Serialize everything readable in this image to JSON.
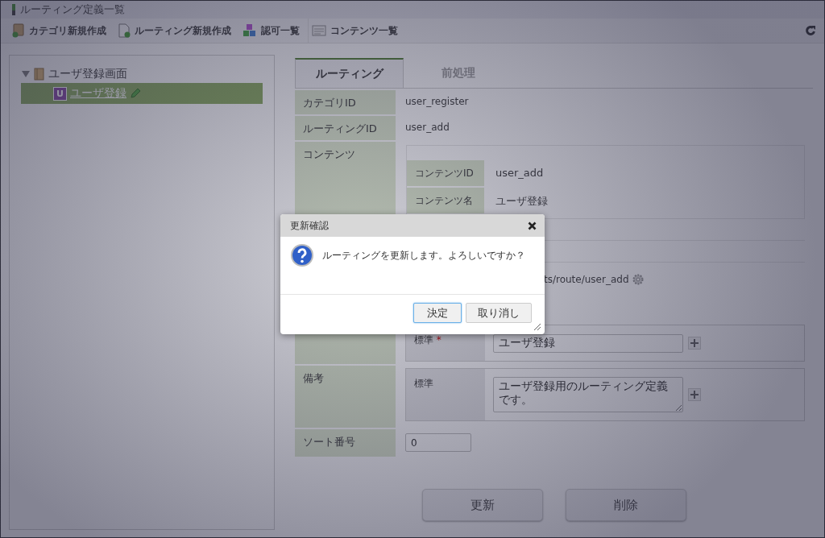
{
  "window": {
    "title": "ルーティング定義一覧"
  },
  "toolbar": [
    {
      "kind": "category",
      "label": "カテゴリ新規作成"
    },
    {
      "kind": "routing",
      "label": "ルーティング新規作成"
    },
    {
      "kind": "auth",
      "label": "認可一覧"
    },
    {
      "kind": "contents",
      "label": "コンテンツ一覧"
    }
  ],
  "tree": [
    {
      "label": "ユーザ登録画面",
      "expanded": true,
      "children": [
        {
          "label": "ユーザ登録",
          "badge": "U",
          "selected": true
        }
      ]
    }
  ],
  "tabs": [
    {
      "label": "ルーティング",
      "selected": true
    },
    {
      "label": "前処理",
      "selected": false
    }
  ],
  "form": [
    {
      "kind": "text",
      "label": "カテゴリID",
      "value": "user_register"
    },
    {
      "kind": "text",
      "label": "ルーティングID",
      "value": "user_add"
    },
    {
      "kind": "contents",
      "label": "コンテンツ",
      "rows": [
        {
          "label": "コンテンツID",
          "value": "user_add"
        },
        {
          "label": "コンテンツ名",
          "value": "ユーザ登録"
        }
      ],
      "path": "ts/route/user_add"
    },
    {
      "kind": "localized",
      "locale": "標準",
      "required_mark": "*",
      "value": "ユーザ登録",
      "multiline": false
    },
    {
      "kind": "localized",
      "label": "備考",
      "locale": "標準",
      "value": "ユーザ登録用のルーティング定義です。",
      "multiline": true
    },
    {
      "kind": "input",
      "label": "ソート番号",
      "value": "0"
    }
  ],
  "actions": [
    {
      "label": "更新"
    },
    {
      "label": "削除"
    }
  ],
  "dialog": {
    "title": "更新確認",
    "message": "ルーティングを更新します。よろしいですか？",
    "buttons": [
      {
        "label": "決定",
        "focused": true
      },
      {
        "label": "取り消し",
        "focused": false
      }
    ]
  }
}
